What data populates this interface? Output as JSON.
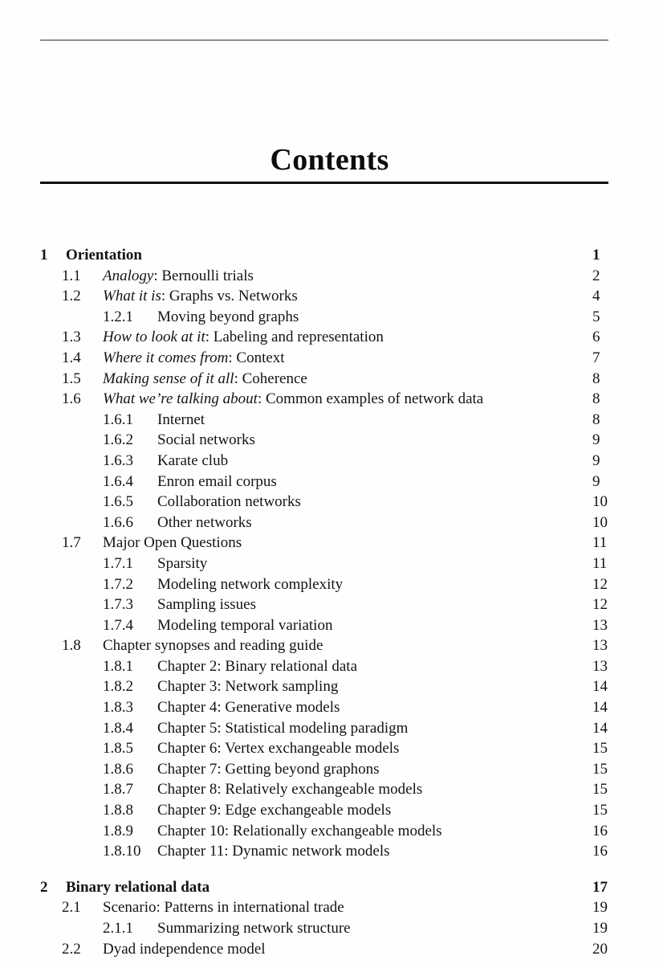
{
  "document": {
    "title": "Contents",
    "rules": {
      "top_color": "#8d8d8d",
      "title_color": "#111111"
    }
  },
  "toc": {
    "entries": [
      {
        "level": "chapter",
        "number": "1",
        "title_italic": "",
        "title_rest": "Orientation",
        "page": "1"
      },
      {
        "level": "section",
        "number": "1.1",
        "title_italic": "Analogy",
        "title_rest": ": Bernoulli trials",
        "page": "2"
      },
      {
        "level": "section",
        "number": "1.2",
        "title_italic": "What it is",
        "title_rest": ": Graphs vs. Networks",
        "page": "4"
      },
      {
        "level": "subsection",
        "number": "1.2.1",
        "title_italic": "",
        "title_rest": "Moving beyond graphs",
        "page": "5"
      },
      {
        "level": "section",
        "number": "1.3",
        "title_italic": "How to look at it",
        "title_rest": ": Labeling and representation",
        "page": "6"
      },
      {
        "level": "section",
        "number": "1.4",
        "title_italic": "Where it comes from",
        "title_rest": ": Context",
        "page": "7"
      },
      {
        "level": "section",
        "number": "1.5",
        "title_italic": "Making sense of it all",
        "title_rest": ": Coherence",
        "page": "8"
      },
      {
        "level": "section",
        "number": "1.6",
        "title_italic": "What we’re talking about",
        "title_rest": ": Common examples of network data",
        "page": "8"
      },
      {
        "level": "subsection",
        "number": "1.6.1",
        "title_italic": "",
        "title_rest": "Internet",
        "page": "8"
      },
      {
        "level": "subsection",
        "number": "1.6.2",
        "title_italic": "",
        "title_rest": "Social networks",
        "page": "9"
      },
      {
        "level": "subsection",
        "number": "1.6.3",
        "title_italic": "",
        "title_rest": "Karate club",
        "page": "9"
      },
      {
        "level": "subsection",
        "number": "1.6.4",
        "title_italic": "",
        "title_rest": "Enron email corpus",
        "page": "9"
      },
      {
        "level": "subsection",
        "number": "1.6.5",
        "title_italic": "",
        "title_rest": "Collaboration networks",
        "page": "10"
      },
      {
        "level": "subsection",
        "number": "1.6.6",
        "title_italic": "",
        "title_rest": "Other networks",
        "page": "10"
      },
      {
        "level": "section",
        "number": "1.7",
        "title_italic": "",
        "title_rest": "Major Open Questions",
        "page": "11"
      },
      {
        "level": "subsection",
        "number": "1.7.1",
        "title_italic": "",
        "title_rest": "Sparsity",
        "page": "11"
      },
      {
        "level": "subsection",
        "number": "1.7.2",
        "title_italic": "",
        "title_rest": "Modeling network complexity",
        "page": "12"
      },
      {
        "level": "subsection",
        "number": "1.7.3",
        "title_italic": "",
        "title_rest": "Sampling issues",
        "page": "12"
      },
      {
        "level": "subsection",
        "number": "1.7.4",
        "title_italic": "",
        "title_rest": "Modeling temporal variation",
        "page": "13"
      },
      {
        "level": "section",
        "number": "1.8",
        "title_italic": "",
        "title_rest": "Chapter synopses and reading guide",
        "page": "13"
      },
      {
        "level": "subsection",
        "number": "1.8.1",
        "title_italic": "",
        "title_rest": "Chapter 2: Binary relational data",
        "page": "13"
      },
      {
        "level": "subsection",
        "number": "1.8.2",
        "title_italic": "",
        "title_rest": "Chapter 3: Network sampling",
        "page": "14"
      },
      {
        "level": "subsection",
        "number": "1.8.3",
        "title_italic": "",
        "title_rest": "Chapter 4: Generative models",
        "page": "14"
      },
      {
        "level": "subsection",
        "number": "1.8.4",
        "title_italic": "",
        "title_rest": "Chapter 5: Statistical modeling paradigm",
        "page": "14"
      },
      {
        "level": "subsection",
        "number": "1.8.5",
        "title_italic": "",
        "title_rest": "Chapter 6: Vertex exchangeable models",
        "page": "15"
      },
      {
        "level": "subsection",
        "number": "1.8.6",
        "title_italic": "",
        "title_rest": "Chapter 7: Getting beyond graphons",
        "page": "15"
      },
      {
        "level": "subsection",
        "number": "1.8.7",
        "title_italic": "",
        "title_rest": "Chapter 8: Relatively exchangeable models",
        "page": "15"
      },
      {
        "level": "subsection",
        "number": "1.8.8",
        "title_italic": "",
        "title_rest": "Chapter 9: Edge exchangeable models",
        "page": "15"
      },
      {
        "level": "subsection",
        "number": "1.8.9",
        "title_italic": "",
        "title_rest": "Chapter 10: Relationally exchangeable models",
        "page": "16"
      },
      {
        "level": "subsection",
        "number": "1.8.10",
        "title_italic": "",
        "title_rest": "Chapter 11: Dynamic network models",
        "page": "16"
      },
      {
        "level": "chapter",
        "number": "2",
        "title_italic": "",
        "title_rest": "Binary relational data",
        "page": "17",
        "gap_before": true
      },
      {
        "level": "section",
        "number": "2.1",
        "title_italic": "",
        "title_rest": "Scenario: Patterns in international trade",
        "page": "19"
      },
      {
        "level": "subsection",
        "number": "2.1.1",
        "title_italic": "",
        "title_rest": "Summarizing network structure",
        "page": "19"
      },
      {
        "level": "section",
        "number": "2.2",
        "title_italic": "",
        "title_rest": "Dyad independence model",
        "page": "20"
      }
    ]
  }
}
